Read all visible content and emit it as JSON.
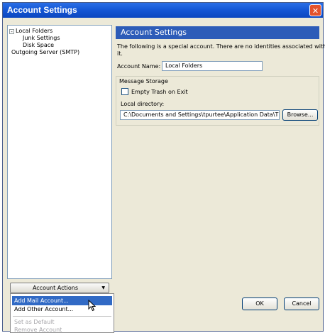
{
  "window": {
    "title": "Account Settings",
    "close_glyph": "✕"
  },
  "tree": {
    "expander": "-",
    "items": [
      {
        "label": "Local Folders"
      },
      {
        "label": "Junk Settings"
      },
      {
        "label": "Disk Space"
      },
      {
        "label": "Outgoing Server (SMTP)"
      }
    ]
  },
  "account_actions": {
    "label": "Account Actions",
    "arrow": "▼",
    "menu": [
      {
        "label": "Add Mail Account...",
        "state": "highlighted"
      },
      {
        "label": "Add Other Account...",
        "state": "enabled"
      },
      {
        "label": "Set as Default",
        "state": "disabled"
      },
      {
        "label": "Remove Account",
        "state": "disabled"
      }
    ]
  },
  "panel": {
    "heading": "Account Settings",
    "description_line1": "The following is a special account. There are no identities associated with",
    "description_line2": "it.",
    "account_name_label": "Account Name:",
    "account_name_value": "Local Folders",
    "message_storage_label": "Message Storage",
    "empty_trash_label": "Empty Trash on Exit",
    "empty_trash_checked": false,
    "local_directory_label": "Local directory:",
    "local_directory_value": "C:\\Documents and Settings\\tpurtee\\Application Data\\Thu",
    "browse_label": "Browse..."
  },
  "footer": {
    "ok_label": "OK",
    "cancel_label": "Cancel"
  },
  "colors": {
    "titlebar": "#1456d4",
    "panel_header": "#2d5cb8",
    "highlight": "#316ac5",
    "close": "#e5532c"
  }
}
